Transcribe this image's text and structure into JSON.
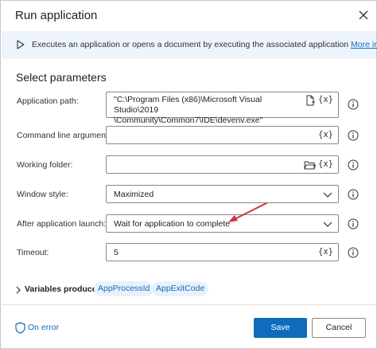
{
  "dialog": {
    "title": "Run application",
    "close_icon": "close-icon"
  },
  "info": {
    "icon": "play-icon",
    "text": "Executes an application or opens a document by executing the associated application",
    "link": "More info"
  },
  "section_title": "Select parameters",
  "params": {
    "app_path": {
      "label": "Application path:",
      "value_line1": "\"C:\\Program Files (x86)\\Microsoft Visual Studio\\2019",
      "value_line2": "\\Community\\Common7\\IDE\\devenv.exe\"",
      "fx": "{x}"
    },
    "cmd_args": {
      "label": "Command line arguments:",
      "value": "",
      "fx": "{x}"
    },
    "working_folder": {
      "label": "Working folder:",
      "value": "",
      "fx": "{x}"
    },
    "window_style": {
      "label": "Window style:",
      "value": "Maximized"
    },
    "after_launch": {
      "label": "After application launch:",
      "value": "Wait for application to complete"
    },
    "timeout": {
      "label": "Timeout:",
      "value": "5",
      "fx": "{x}"
    }
  },
  "variables": {
    "label": "Variables produced",
    "items": [
      "AppProcessId",
      "AppExitCode"
    ]
  },
  "footer": {
    "on_error": "On error",
    "save": "Save",
    "cancel": "Cancel"
  },
  "colors": {
    "accent": "#0f6cbd",
    "info_bar": "#eef4fc",
    "annotation_arrow": "#d13438"
  }
}
